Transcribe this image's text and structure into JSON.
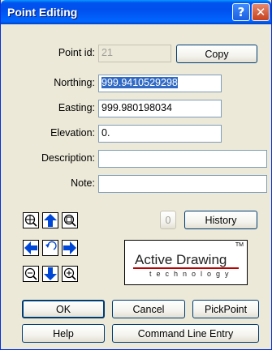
{
  "window": {
    "title": "Point Editing",
    "help_glyph": "?",
    "close_glyph": "✕"
  },
  "fields": {
    "point_id": {
      "label": "Point id:",
      "value": "21"
    },
    "northing": {
      "label": "Northing:",
      "value": "999.9410529298"
    },
    "easting": {
      "label": "Easting:",
      "value": "999.980198034"
    },
    "elevation": {
      "label": "Elevation:",
      "value": "0."
    },
    "description": {
      "label": "Description:",
      "value": ""
    },
    "note": {
      "label": "Note:",
      "value": ""
    }
  },
  "buttons": {
    "copy": "Copy",
    "zero": "0",
    "history": "History",
    "ok": "OK",
    "cancel": "Cancel",
    "pickpoint": "PickPoint",
    "help": "Help",
    "command_line": "Command Line Entry"
  },
  "logo": {
    "main": "Active Drawing",
    "sub": "technology",
    "tm": "TM"
  },
  "colors": {
    "titlebar": "#0054e3",
    "dialog_bg": "#ece9d8",
    "selection": "#316ac5",
    "arrow_blue": "#0047d6"
  }
}
